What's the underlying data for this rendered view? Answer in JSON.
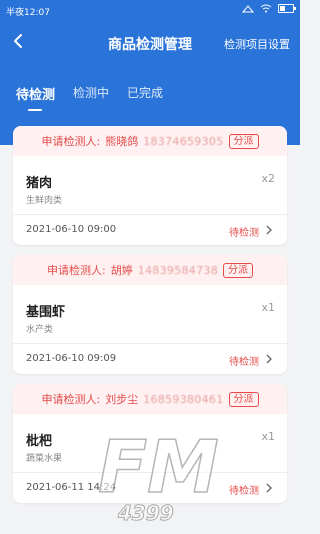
{
  "status_bar": {
    "time": "半夜12:07",
    "battery": 0.45
  },
  "header": {
    "title": "商品检测管理",
    "settings_label": "检测项目设置"
  },
  "tabs": [
    {
      "label": "待检测",
      "active": true
    },
    {
      "label": "检测中",
      "active": false
    },
    {
      "label": "已完成",
      "active": false
    }
  ],
  "cards": [
    {
      "applicant_label": "申请检测人:",
      "name": "熊晓鸽",
      "phone": "18374659305",
      "assign": "分派",
      "product": "猪肉",
      "category": "生鲜肉类",
      "qty": "x2",
      "date": "2021-06-10 09:00",
      "status": "待检测"
    },
    {
      "applicant_label": "申请检测人:",
      "name": "胡婷",
      "phone": "14839584738",
      "assign": "分派",
      "product": "基围虾",
      "category": "水产类",
      "qty": "x1",
      "date": "2021-06-10 09:09",
      "status": "待检测"
    },
    {
      "applicant_label": "申请检测人:",
      "name": "刘步尘",
      "phone": "16859380461",
      "assign": "分派",
      "product": "枇杷",
      "category": "蔬菜水果",
      "qty": "x1",
      "date": "2021-06-11 14:24",
      "status": "待检测"
    }
  ],
  "colors": {
    "primary": "#2a73d8",
    "danger": "#e54b4b",
    "head_bg": "#fff1f1"
  },
  "watermark": {
    "text_main": "FM",
    "text_sub": "4399"
  }
}
